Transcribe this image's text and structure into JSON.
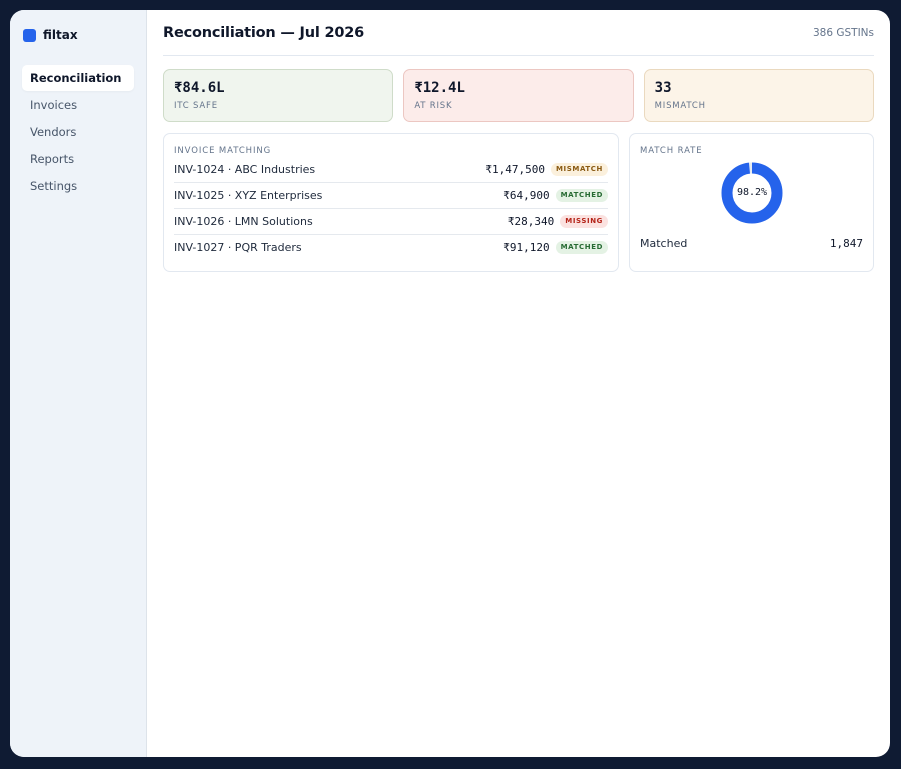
{
  "brand": {
    "name": "filtax",
    "color": "#2563eb"
  },
  "sidebar": {
    "items": [
      {
        "label": "Reconciliation",
        "active": true
      },
      {
        "label": "Invoices",
        "active": false
      },
      {
        "label": "Vendors",
        "active": false
      },
      {
        "label": "Reports",
        "active": false
      },
      {
        "label": "Settings",
        "active": false
      }
    ]
  },
  "header": {
    "title": "Reconciliation — Jul 2026",
    "gstin_count": "386 GSTINs"
  },
  "kpis": [
    {
      "value": "₹84.6L",
      "label": "ITC SAFE",
      "tone": "safe"
    },
    {
      "value": "₹12.4L",
      "label": "AT RISK",
      "tone": "risk"
    },
    {
      "value": "33",
      "label": "MISMATCH",
      "tone": "mismatch"
    }
  ],
  "matching": {
    "title": "INVOICE MATCHING",
    "rows": [
      {
        "name": "INV-1024 · ABC Industries",
        "amount": "₹1,47,500",
        "status": "MISMATCH",
        "tone": "mismatch"
      },
      {
        "name": "INV-1025 · XYZ Enterprises",
        "amount": "₹64,900",
        "status": "MATCHED",
        "tone": "matched"
      },
      {
        "name": "INV-1026 · LMN Solutions",
        "amount": "₹28,340",
        "status": "MISSING",
        "tone": "missing"
      },
      {
        "name": "INV-1027 · PQR Traders",
        "amount": "₹91,120",
        "status": "MATCHED",
        "tone": "matched"
      }
    ]
  },
  "match_rate": {
    "title": "MATCH RATE",
    "percent_label": "98.2%",
    "percent": 98.2,
    "color": "#2563eb",
    "matched_label": "Matched",
    "matched_value": "1,847"
  }
}
